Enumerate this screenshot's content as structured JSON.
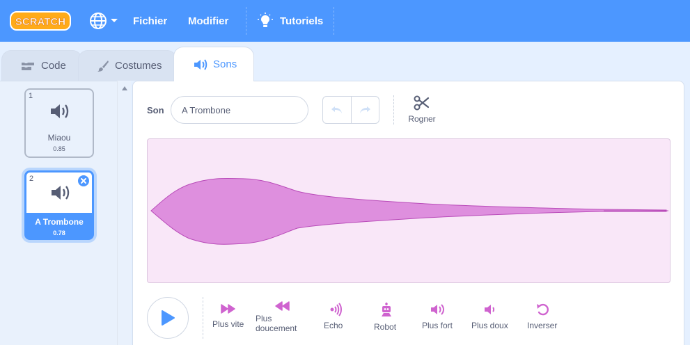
{
  "menu": {
    "logo_text": "SCRATCH",
    "file": "Fichier",
    "edit": "Modifier",
    "tutorials": "Tutoriels"
  },
  "tabs": {
    "code": "Code",
    "costumes": "Costumes",
    "sounds": "Sons"
  },
  "sounds": [
    {
      "number": "1",
      "name": "Miaou",
      "duration": "0.85",
      "selected": false
    },
    {
      "number": "2",
      "name": "A Trombone",
      "duration": "0.78",
      "selected": true
    }
  ],
  "editor": {
    "sound_label": "Son",
    "sound_name": "A Trombone",
    "trim_label": "Rogner"
  },
  "effects": {
    "faster": "Plus vite",
    "slower_line1": "Plus",
    "slower_line2": "doucement",
    "echo": "Echo",
    "robot": "Robot",
    "louder": "Plus fort",
    "softer": "Plus doux",
    "reverse": "Inverser"
  },
  "colors": {
    "accent": "#4c97ff",
    "effect": "#cf63cf",
    "wave_fill": "#de8fde",
    "wave_bg": "#f9e7f8"
  }
}
